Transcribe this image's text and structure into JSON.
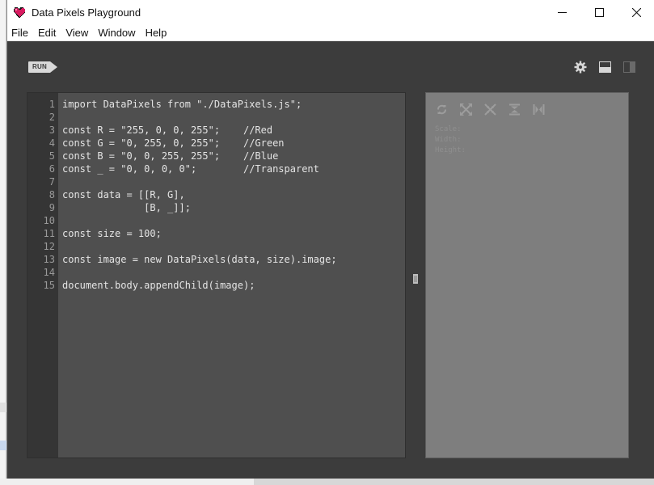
{
  "window": {
    "title": "Data Pixels Playground",
    "accent_heart": "#c2185b"
  },
  "menubar": {
    "items": [
      "File",
      "Edit",
      "View",
      "Window",
      "Help"
    ]
  },
  "toolbar": {
    "run_label": "RUN",
    "right_icons": [
      "gear-icon",
      "layout-horizontal-icon",
      "layout-vertical-icon"
    ]
  },
  "editor": {
    "line_numbers": [
      "1",
      "2",
      "3",
      "4",
      "5",
      "6",
      "7",
      "8",
      "9",
      "10",
      "11",
      "12",
      "13",
      "14",
      "15"
    ],
    "lines": [
      "import DataPixels from \"./DataPixels.js\";",
      "",
      "const R = \"255, 0, 0, 255\";    //Red",
      "const G = \"0, 255, 0, 255\";    //Green",
      "const B = \"0, 0, 255, 255\";    //Blue",
      "const _ = \"0, 0, 0, 0\";        //Transparent",
      "",
      "const data = [[R, G],",
      "              [B, _]];",
      "",
      "const size = 100;",
      "",
      "const image = new DataPixels(data, size).image;",
      "",
      "document.body.appendChild(image);"
    ]
  },
  "preview": {
    "tool_icons": [
      "refresh-icon",
      "expand-icon",
      "collapse-icon",
      "flip-vertical-icon",
      "flip-horizontal-icon"
    ],
    "stats": {
      "scale_label": "Scale:",
      "width_label": "Width:",
      "height_label": "Height:"
    }
  }
}
